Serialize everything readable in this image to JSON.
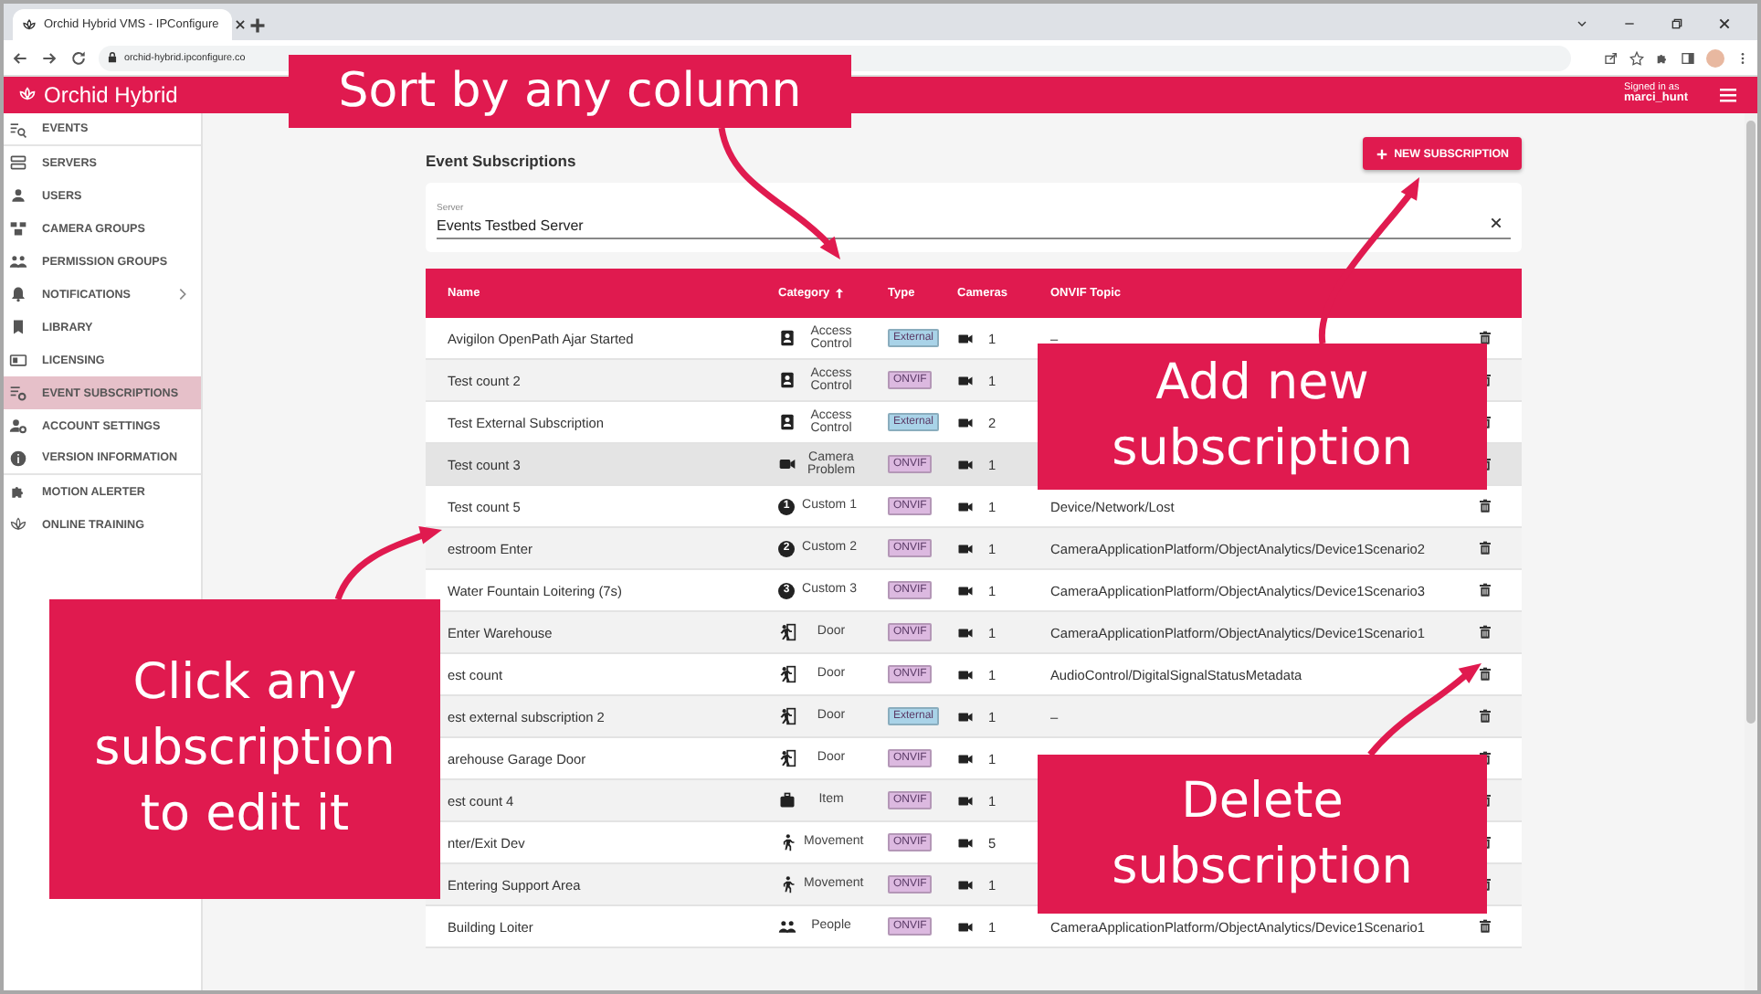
{
  "browser": {
    "tab_title": "Orchid Hybrid VMS - IPConfigure",
    "url": "orchid-hybrid.ipconfigure.co"
  },
  "app_header": {
    "title": "Orchid Hybrid",
    "signed_in_label": "Signed in as",
    "user": "marci_hunt"
  },
  "sidebar": {
    "items": [
      {
        "label": "EVENTS",
        "kind": "search-list",
        "selected": false,
        "has_submenu": false,
        "divider_after": true
      },
      {
        "label": "SERVERS",
        "kind": "server",
        "selected": false,
        "has_submenu": false,
        "divider_after": false
      },
      {
        "label": "USERS",
        "kind": "person",
        "selected": false,
        "has_submenu": false,
        "divider_after": false
      },
      {
        "label": "CAMERA GROUPS",
        "kind": "camera-group",
        "selected": false,
        "has_submenu": false,
        "divider_after": false
      },
      {
        "label": "PERMISSION GROUPS",
        "kind": "people",
        "selected": false,
        "has_submenu": false,
        "divider_after": false
      },
      {
        "label": "NOTIFICATIONS",
        "kind": "bell",
        "selected": false,
        "has_submenu": true,
        "divider_after": false
      },
      {
        "label": "LIBRARY",
        "kind": "bookmark",
        "selected": false,
        "has_submenu": false,
        "divider_after": false
      },
      {
        "label": "LICENSING",
        "kind": "card",
        "selected": false,
        "has_submenu": false,
        "divider_after": false
      },
      {
        "label": "EVENT SUBSCRIPTIONS",
        "kind": "list-gear",
        "selected": true,
        "has_submenu": false,
        "divider_after": false
      },
      {
        "label": "ACCOUNT SETTINGS",
        "kind": "person-gear",
        "selected": false,
        "has_submenu": false,
        "divider_after": false
      },
      {
        "label": "VERSION INFORMATION",
        "kind": "info",
        "selected": false,
        "has_submenu": false,
        "divider_after": true
      },
      {
        "label": "MOTION ALERTER",
        "kind": "puzzle",
        "selected": false,
        "has_submenu": false,
        "divider_after": false
      },
      {
        "label": "ONLINE TRAINING",
        "kind": "lotus",
        "selected": false,
        "has_submenu": false,
        "divider_after": false
      }
    ]
  },
  "page": {
    "title": "Event Subscriptions",
    "new_button": "NEW SUBSCRIPTION"
  },
  "server_field": {
    "label": "Server",
    "value": "Events Testbed Server"
  },
  "table": {
    "columns": [
      {
        "label": "Name",
        "sorted": false
      },
      {
        "label": "Category",
        "sorted": true
      },
      {
        "label": "Type",
        "sorted": false
      },
      {
        "label": "Cameras",
        "sorted": false
      },
      {
        "label": "ONVIF Topic",
        "sorted": false
      }
    ],
    "rows": [
      {
        "name": "Avigilon OpenPath Ajar Started",
        "category": "Access Control",
        "kind": "access",
        "type": {
          "label": "External",
          "color": "#a9d3e8"
        },
        "cameras": "1",
        "topic": "–",
        "highlighted": false
      },
      {
        "name": "Test count 2",
        "category": "Access Control",
        "kind": "access",
        "type": {
          "label": "ONVIF",
          "color": "#dcb9e0"
        },
        "cameras": "1",
        "highlighted": false
      },
      {
        "name": "Test External Subscription",
        "category": "Access Control",
        "kind": "access",
        "type": {
          "label": "External",
          "color": "#a9d3e8"
        },
        "cameras": "2",
        "highlighted": false
      },
      {
        "name": "Test count 3",
        "category": "Camera Problem",
        "kind": "camera",
        "type": {
          "label": "ONVIF",
          "color": "#dcb9e0"
        },
        "cameras": "1",
        "highlighted": true
      },
      {
        "name": "Test count 5",
        "category": "Custom 1",
        "kind": "number",
        "icon_label": "1",
        "type": {
          "label": "ONVIF",
          "color": "#dcb9e0"
        },
        "cameras": "1",
        "topic": "Device/Network/Lost",
        "highlighted": false
      },
      {
        "name": "estroom Enter",
        "category": "Custom 2",
        "kind": "number",
        "icon_label": "2",
        "type": {
          "label": "ONVIF",
          "color": "#dcb9e0"
        },
        "cameras": "1",
        "topic": "CameraApplicationPlatform/ObjectAnalytics/Device1Scenario2",
        "highlighted": false
      },
      {
        "name": "Water Fountain Loitering (7s)",
        "category": "Custom 3",
        "kind": "number",
        "icon_label": "3",
        "type": {
          "label": "ONVIF",
          "color": "#dcb9e0"
        },
        "cameras": "1",
        "topic": "CameraApplicationPlatform/ObjectAnalytics/Device1Scenario3",
        "highlighted": false
      },
      {
        "name": "Enter Warehouse",
        "category": "Door",
        "kind": "door",
        "type": {
          "label": "ONVIF",
          "color": "#dcb9e0"
        },
        "cameras": "1",
        "topic": "CameraApplicationPlatform/ObjectAnalytics/Device1Scenario1",
        "highlighted": false
      },
      {
        "name": "est count",
        "category": "Door",
        "kind": "door",
        "type": {
          "label": "ONVIF",
          "color": "#dcb9e0"
        },
        "cameras": "1",
        "topic": "AudioControl/DigitalSignalStatusMetadata",
        "highlighted": false
      },
      {
        "name": "est external subscription 2",
        "category": "Door",
        "kind": "door",
        "type": {
          "label": "External",
          "color": "#a9d3e8"
        },
        "cameras": "1",
        "topic": "–",
        "highlighted": false
      },
      {
        "name": "arehouse Garage Door",
        "category": "Door",
        "kind": "door",
        "type": {
          "label": "ONVIF",
          "color": "#dcb9e0"
        },
        "cameras": "1",
        "highlighted": false
      },
      {
        "name": "est count 4",
        "category": "Item",
        "kind": "item",
        "type": {
          "label": "ONVIF",
          "color": "#dcb9e0"
        },
        "cameras": "1",
        "highlighted": false
      },
      {
        "name": "nter/Exit Dev",
        "category": "Movement",
        "kind": "movement",
        "type": {
          "label": "ONVIF",
          "color": "#dcb9e0"
        },
        "cameras": "5",
        "highlighted": false
      },
      {
        "name": "Entering Support Area",
        "category": "Movement",
        "kind": "movement",
        "type": {
          "label": "ONVIF",
          "color": "#dcb9e0"
        },
        "cameras": "1",
        "highlighted": false
      },
      {
        "name": "Building Loiter",
        "category": "People",
        "kind": "people",
        "type": {
          "label": "ONVIF",
          "color": "#dcb9e0"
        },
        "cameras": "1",
        "topic": "CameraApplicationPlatform/ObjectAnalytics/Device1Scenario1",
        "highlighted": false
      }
    ]
  },
  "callouts": [
    {
      "text": "Sort by any column"
    },
    {
      "text": "Add new subscription"
    },
    {
      "text": "Click any subscription to edit it"
    },
    {
      "text": "Delete subscription"
    }
  ]
}
